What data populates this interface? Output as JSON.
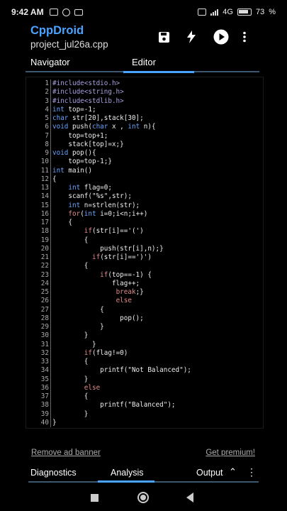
{
  "status": {
    "time": "9:42 AM",
    "network": "4G",
    "battery": "73"
  },
  "header": {
    "title": "CppDroid",
    "subtitle": "project_jul26a.cpp"
  },
  "tabs": {
    "navigator": "Navigator",
    "editor": "Editor"
  },
  "code": [
    [
      [
        "pp",
        "#include<stdio.h>"
      ]
    ],
    [
      [
        "pp",
        "#include<string.h>"
      ]
    ],
    [
      [
        "pp",
        "#include<stdlib.h>"
      ]
    ],
    [
      [
        "kw",
        "int"
      ],
      [
        "txt",
        " top=-1;"
      ]
    ],
    [
      [
        "kw",
        "char"
      ],
      [
        "txt",
        " str[20],stack[30];"
      ]
    ],
    [
      [
        "kw",
        "void"
      ],
      [
        "txt",
        " push("
      ],
      [
        "kw",
        "char"
      ],
      [
        "txt",
        " x , "
      ],
      [
        "kw",
        "int"
      ],
      [
        "txt",
        " n){"
      ]
    ],
    [
      [
        "txt",
        "    top=top+1;"
      ]
    ],
    [
      [
        "txt",
        "    stack[top]=x;}"
      ]
    ],
    [
      [
        "kw",
        "void"
      ],
      [
        "txt",
        " pop(){"
      ]
    ],
    [
      [
        "txt",
        "    top=top-1;}"
      ]
    ],
    [
      [
        "kw",
        "int"
      ],
      [
        "txt",
        " main()"
      ]
    ],
    [
      [
        "txt",
        "{"
      ]
    ],
    [
      [
        "txt",
        "    "
      ],
      [
        "kw",
        "int"
      ],
      [
        "txt",
        " flag=0;"
      ]
    ],
    [
      [
        "txt",
        "    scanf(\"%s\",str);"
      ]
    ],
    [
      [
        "txt",
        "    "
      ],
      [
        "kw",
        "int"
      ],
      [
        "txt",
        " n=strlen(str);"
      ]
    ],
    [
      [
        "txt",
        "    "
      ],
      [
        "flow",
        "for"
      ],
      [
        "txt",
        "("
      ],
      [
        "kw",
        "int"
      ],
      [
        "txt",
        " i=0;i<n;i++)"
      ]
    ],
    [
      [
        "txt",
        "    {"
      ]
    ],
    [
      [
        "txt",
        "        "
      ],
      [
        "flow",
        "if"
      ],
      [
        "txt",
        "(str[i]=='(')"
      ]
    ],
    [
      [
        "txt",
        "        {"
      ]
    ],
    [
      [
        "txt",
        "            push(str[i],n);}"
      ]
    ],
    [
      [
        "txt",
        "          "
      ],
      [
        "flow",
        "if"
      ],
      [
        "txt",
        "(str[i]==')')"
      ]
    ],
    [
      [
        "txt",
        "        {"
      ]
    ],
    [
      [
        "txt",
        "            "
      ],
      [
        "flow",
        "if"
      ],
      [
        "txt",
        "(top==-1) {"
      ]
    ],
    [
      [
        "txt",
        "               flag++;"
      ]
    ],
    [
      [
        "txt",
        "                "
      ],
      [
        "flow",
        "break"
      ],
      [
        "txt",
        ";}"
      ]
    ],
    [
      [
        "txt",
        "                "
      ],
      [
        "flow",
        "else"
      ]
    ],
    [
      [
        "txt",
        "            {"
      ]
    ],
    [
      [
        "txt",
        "                 pop();"
      ]
    ],
    [
      [
        "txt",
        "            }"
      ]
    ],
    [
      [
        "txt",
        "        }"
      ]
    ],
    [
      [
        "txt",
        "          }"
      ]
    ],
    [
      [
        "txt",
        "        "
      ],
      [
        "flow",
        "if"
      ],
      [
        "txt",
        "(flag!=0)"
      ]
    ],
    [
      [
        "txt",
        "        {"
      ]
    ],
    [
      [
        "txt",
        "            printf(\"Not Balanced\");"
      ]
    ],
    [
      [
        "txt",
        "        }"
      ]
    ],
    [
      [
        "txt",
        "        "
      ],
      [
        "flow",
        "else"
      ]
    ],
    [
      [
        "txt",
        "        {"
      ]
    ],
    [
      [
        "txt",
        "            printf(\"Balanced\");"
      ]
    ],
    [
      [
        "txt",
        "        }"
      ]
    ],
    [
      [
        "txt",
        "}"
      ]
    ]
  ],
  "ad": {
    "remove": "Remove ad banner",
    "premium": "Get premium!"
  },
  "bottom_tabs": {
    "diagnostics": "Diagnostics",
    "analysis": "Analysis",
    "output": "Output"
  },
  "icons": {
    "save": "save-icon",
    "build": "lightning-icon",
    "run": "play-icon",
    "menu": "more-vertical-icon"
  },
  "colors": {
    "accent": "#4aa3ff",
    "keyword": "#69a4ff",
    "flow": "#e28a8a",
    "preprocessor": "#a8a0e0"
  }
}
